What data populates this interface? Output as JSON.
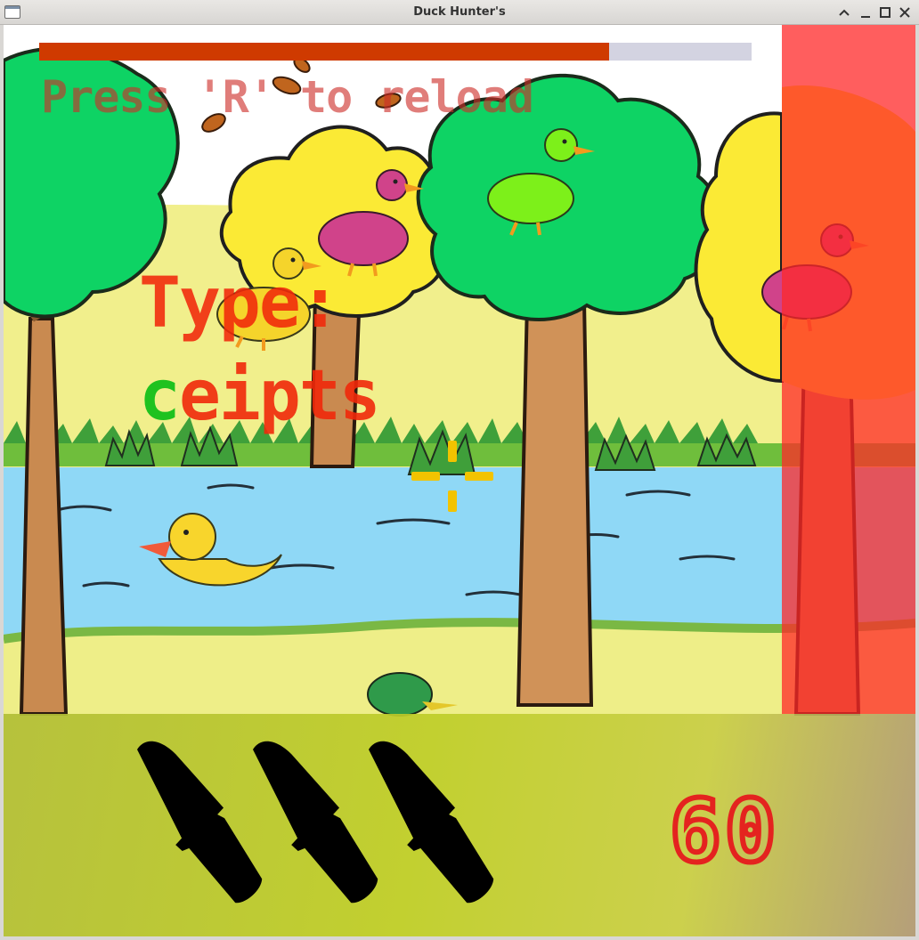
{
  "window": {
    "title": "Duck Hunter's",
    "icons": [
      "app-window-icon",
      "collapse-icon",
      "minimize-icon",
      "maximize-icon",
      "close-icon"
    ]
  },
  "hud": {
    "health_fraction": 0.8,
    "reload_hint": "Press 'R' to reload",
    "type_label": "Type:",
    "target_word": {
      "typed": "c",
      "remaining": "eipts"
    },
    "timer": "60",
    "bullets_remaining": 3
  },
  "colors": {
    "health_fill": "#cf3a00",
    "health_track": "#d3d3e1",
    "typed_text": "#1fc21f",
    "untyped_text": "#f0280a",
    "danger_zone": "#ff2828",
    "crosshair": "#f2c300",
    "timer": "#e4231f",
    "ammo_panel": "#bccc37"
  }
}
